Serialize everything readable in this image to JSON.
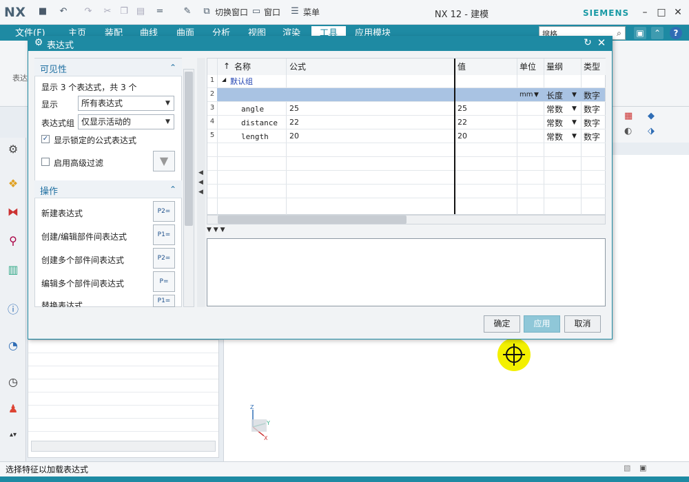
{
  "app": {
    "logo": "NX",
    "title": "NX 12 - 建模",
    "brand": "SIEMENS",
    "quick": {
      "switch_window": "切换窗口",
      "window_menu": "窗口",
      "menu": "菜单"
    }
  },
  "ribbon": {
    "tabs": [
      "文件(F)",
      "主页",
      "装配",
      "曲线",
      "曲面",
      "分析",
      "视图",
      "渲染",
      "工具",
      "应用模块"
    ],
    "active_tab": "工具",
    "search_placeholder": "搜格",
    "group_label": "表达"
  },
  "dialog": {
    "title": "表达式",
    "visibility": {
      "section_title": "可见性",
      "summary": "显示 3 个表达式，共 3 个",
      "show_label": "显示",
      "show_value": "所有表达式",
      "group_label": "表达式组",
      "group_value": "仅显示活动的",
      "locked_checkbox": "显示锁定的公式表达式",
      "locked_checked": true,
      "advanced_checkbox": "启用高级过滤",
      "advanced_checked": false
    },
    "actions": {
      "section_title": "操作",
      "items": [
        "新建表达式",
        "创建/编辑部件间表达式",
        "创建多个部件间表达式",
        "编辑多个部件间表达式",
        "替换表达式"
      ]
    },
    "table": {
      "columns": [
        "名称",
        "公式",
        "值",
        "单位",
        "量纲",
        "类型"
      ],
      "group_row": {
        "num": "1",
        "name": "默认组"
      },
      "edit_row": {
        "num": "2",
        "unit": "mm",
        "dimension": "长度",
        "type": "数字"
      },
      "rows": [
        {
          "num": "3",
          "name": "angle",
          "formula": "25",
          "value": "25",
          "dimension": "常数",
          "type": "数字"
        },
        {
          "num": "4",
          "name": "distance",
          "formula": "22",
          "value": "22",
          "dimension": "常数",
          "type": "数字"
        },
        {
          "num": "5",
          "name": "length",
          "formula": "20",
          "value": "20",
          "dimension": "常数",
          "type": "数字"
        }
      ]
    },
    "buttons": {
      "ok": "确定",
      "apply": "应用",
      "cancel": "取消"
    }
  },
  "status": {
    "message": "选择特征以加载表达式"
  },
  "colors": {
    "accent": "#1e8aa3",
    "selection": "#a9c3e3",
    "cursor_highlight": "#f3f000"
  }
}
